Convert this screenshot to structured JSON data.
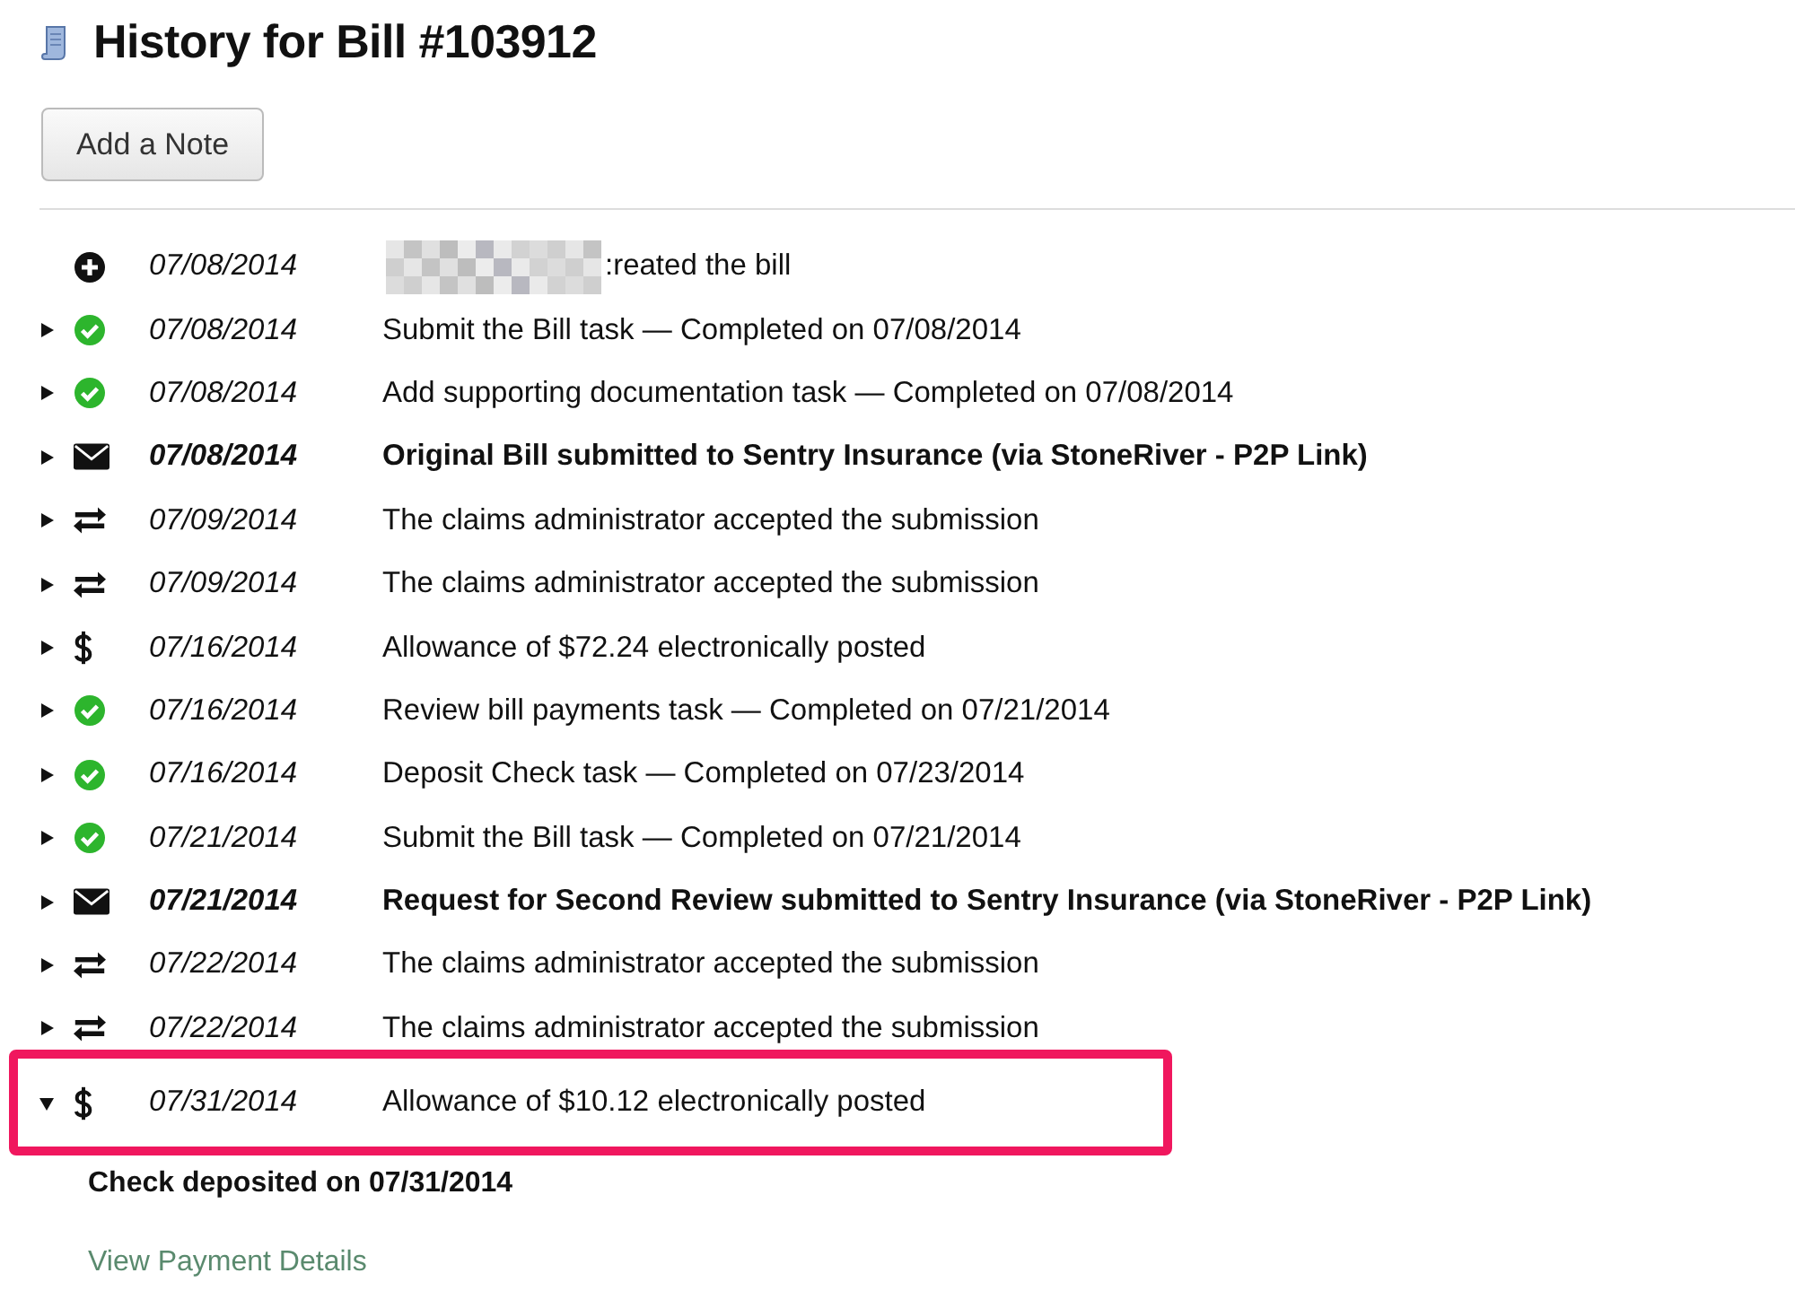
{
  "title": "History for Bill #103912",
  "add_note_button": "Add a Note",
  "events": [
    {
      "expandable": false,
      "kind": "plus",
      "date": "07/08/2014",
      "text": ":reated the bill",
      "bold": false,
      "highlighted": false,
      "redacted_prefix": true
    },
    {
      "expandable": true,
      "expanded": false,
      "kind": "check",
      "date": "07/08/2014",
      "text": "Submit the Bill task — Completed on 07/08/2014",
      "bold": false,
      "highlighted": false
    },
    {
      "expandable": true,
      "expanded": false,
      "kind": "check",
      "date": "07/08/2014",
      "text": "Add supporting documentation task — Completed on 07/08/2014",
      "bold": false,
      "highlighted": false
    },
    {
      "expandable": true,
      "expanded": false,
      "kind": "mail",
      "date": "07/08/2014",
      "text": "Original Bill submitted to Sentry Insurance (via StoneRiver - P2P Link)",
      "bold": true,
      "highlighted": false
    },
    {
      "expandable": true,
      "expanded": false,
      "kind": "transfer",
      "date": "07/09/2014",
      "text": "The claims administrator accepted the submission",
      "bold": false,
      "highlighted": false
    },
    {
      "expandable": true,
      "expanded": false,
      "kind": "transfer",
      "date": "07/09/2014",
      "text": "The claims administrator accepted the submission",
      "bold": false,
      "highlighted": false
    },
    {
      "expandable": true,
      "expanded": false,
      "kind": "dollar",
      "date": "07/16/2014",
      "text": "Allowance of $72.24 electronically posted",
      "bold": false,
      "highlighted": false
    },
    {
      "expandable": true,
      "expanded": false,
      "kind": "check",
      "date": "07/16/2014",
      "text": "Review bill payments task — Completed on 07/21/2014",
      "bold": false,
      "highlighted": false
    },
    {
      "expandable": true,
      "expanded": false,
      "kind": "check",
      "date": "07/16/2014",
      "text": "Deposit Check task — Completed on 07/23/2014",
      "bold": false,
      "highlighted": false
    },
    {
      "expandable": true,
      "expanded": false,
      "kind": "check",
      "date": "07/21/2014",
      "text": "Submit the Bill task — Completed on 07/21/2014",
      "bold": false,
      "highlighted": false
    },
    {
      "expandable": true,
      "expanded": false,
      "kind": "mail",
      "date": "07/21/2014",
      "text": "Request for Second Review submitted to Sentry Insurance (via StoneRiver - P2P Link)",
      "bold": true,
      "highlighted": false
    },
    {
      "expandable": true,
      "expanded": false,
      "kind": "transfer",
      "date": "07/22/2014",
      "text": "The claims administrator accepted the submission",
      "bold": false,
      "highlighted": false
    },
    {
      "expandable": true,
      "expanded": false,
      "kind": "transfer",
      "date": "07/22/2014",
      "text": "The claims administrator accepted the submission",
      "bold": false,
      "highlighted": false
    },
    {
      "expandable": true,
      "expanded": true,
      "kind": "dollar",
      "date": "07/31/2014",
      "text": "Allowance of $10.12 electronically posted",
      "bold": false,
      "highlighted": true,
      "details": {
        "heading": "Check deposited on 07/31/2014",
        "link": "View Payment Details"
      }
    }
  ]
}
